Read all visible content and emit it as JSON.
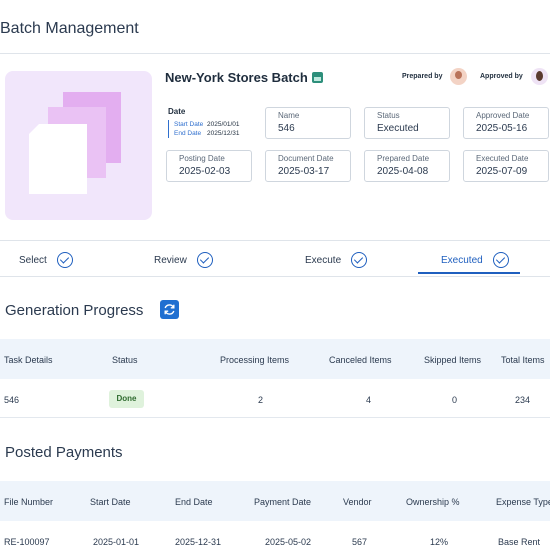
{
  "page": {
    "title": "Batch Management"
  },
  "batch": {
    "title": "New-York Stores Batch",
    "prepared_by_label": "Prepared by",
    "approved_by_label": "Approved by",
    "date_label": "Date",
    "start_date_label": "Start Date",
    "start_date": "2025/01/01",
    "end_date_label": "End Date",
    "end_date": "2025/12/31",
    "fields": [
      {
        "label": "Name",
        "value": "546"
      },
      {
        "label": "Status",
        "value": "Executed"
      },
      {
        "label": "Approved Date",
        "value": "2025-05-16"
      },
      {
        "label": "Posting Date",
        "value": "2025-02-03"
      },
      {
        "label": "Document Date",
        "value": "2025-03-17"
      },
      {
        "label": "Prepared Date",
        "value": "2025-04-08"
      },
      {
        "label": "Executed Date",
        "value": "2025-07-09"
      }
    ]
  },
  "steps": [
    {
      "label": "Select"
    },
    {
      "label": "Review"
    },
    {
      "label": "Execute"
    },
    {
      "label": "Executed"
    }
  ],
  "generation": {
    "title": "Generation Progress",
    "columns": [
      "Task Details",
      "Status",
      "Processing Items",
      "Canceled Items",
      "Skipped Items",
      "Total Items"
    ],
    "row": {
      "task": "546",
      "status": "Done",
      "processing": "2",
      "canceled": "4",
      "skipped": "0",
      "total": "234"
    }
  },
  "payments": {
    "title": "Posted Payments",
    "columns": [
      "File Number",
      "Start Date",
      "End Date",
      "Payment Date",
      "Vendor",
      "Ownership %",
      "Expense Type"
    ],
    "row": {
      "file": "RE-100097",
      "start": "2025-01-01",
      "end": "2025-12-31",
      "payment": "2025-05-02",
      "vendor": "567",
      "ownership": "12%",
      "expense": "Base Rent"
    }
  },
  "colors": {
    "accent": "#1f5fbf",
    "done_bg": "#dff2dc",
    "table_header_bg": "#eef4fb",
    "thumb_bg": "#f1e6fb"
  },
  "icons": [
    "store-icon",
    "check-circle-icon",
    "refresh-icon",
    "avatar"
  ]
}
